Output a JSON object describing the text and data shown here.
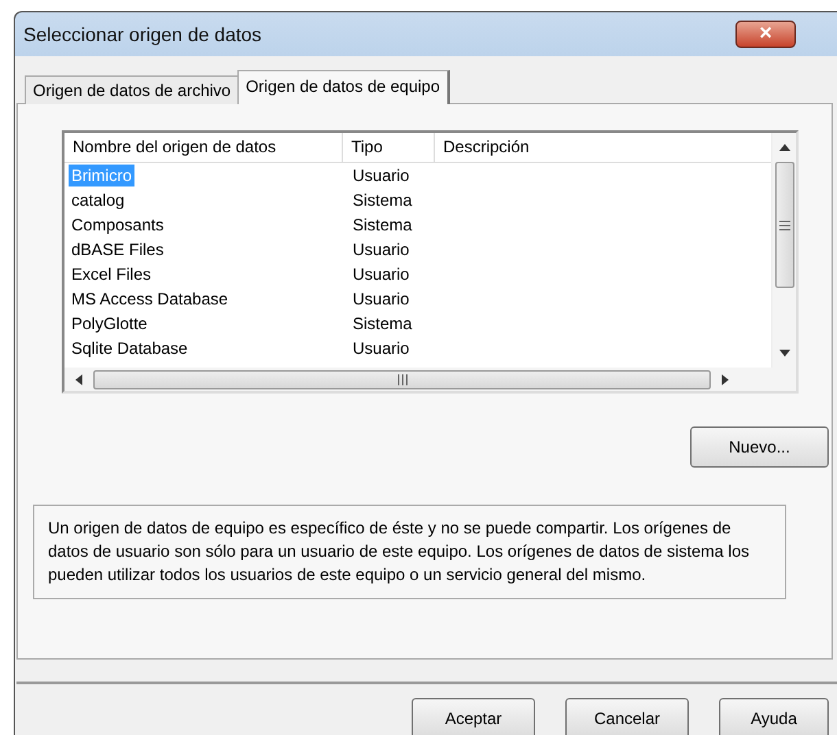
{
  "window": {
    "title": "Seleccionar origen de datos",
    "close": "×"
  },
  "tabs": [
    {
      "label": "Origen de datos de archivo",
      "selected": false
    },
    {
      "label": "Origen de datos de equipo",
      "selected": true
    }
  ],
  "table": {
    "columns": [
      "Nombre del origen de datos",
      "Tipo",
      "Descripción"
    ],
    "rows": [
      {
        "name": "Brimicro",
        "type": "Usuario",
        "selected": true
      },
      {
        "name": "catalog",
        "type": "Sistema",
        "selected": false
      },
      {
        "name": "Composants",
        "type": "Sistema",
        "selected": false
      },
      {
        "name": "dBASE Files",
        "type": "Usuario",
        "selected": false
      },
      {
        "name": "Excel Files",
        "type": "Usuario",
        "selected": false
      },
      {
        "name": "MS Access Database",
        "type": "Usuario",
        "selected": false
      },
      {
        "name": "PolyGlotte",
        "type": "Sistema",
        "selected": false
      },
      {
        "name": "Sqlite Database",
        "type": "Usuario",
        "selected": false
      }
    ]
  },
  "new_button": "Nuevo...",
  "info": "Un origen de datos de equipo es específico de éste y no se puede compartir. Los orígenes de datos de usuario son sólo para un usuario de este equipo. Los orígenes de datos de sistema los pueden utilizar todos los usuarios de este equipo o un servicio general del mismo.",
  "buttons": [
    "Aceptar",
    "Cancelar",
    "Ayuda"
  ]
}
